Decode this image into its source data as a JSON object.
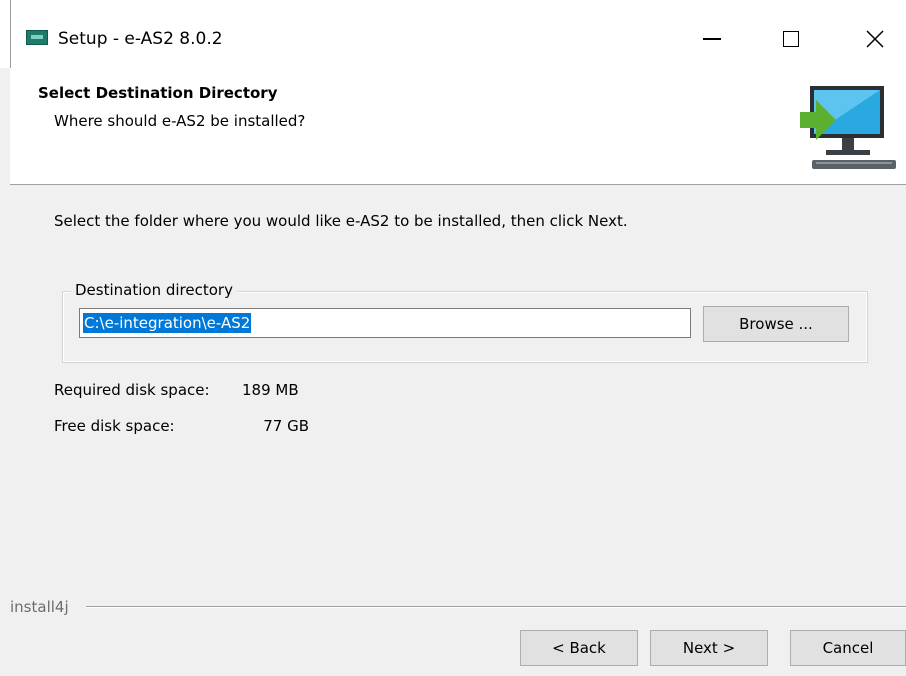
{
  "window": {
    "title": "Setup - e-AS2 8.0.2"
  },
  "header": {
    "title": "Select Destination Directory",
    "subtitle": "Where should e-AS2 be installed?"
  },
  "content": {
    "instruction": "Select the folder where you would like e-AS2 to be installed, then click Next.",
    "destination": {
      "legend": "Destination directory",
      "value": "C:\\e-integration\\e-AS2",
      "browse_label": "Browse ..."
    },
    "required_space_label": "Required disk space:",
    "required_space_value": "189 MB",
    "free_space_label": "Free disk space:",
    "free_space_value": "77 GB"
  },
  "footer": {
    "brand": "install4j",
    "back_label": "< Back",
    "next_label": "Next >",
    "cancel_label": "Cancel"
  },
  "colors": {
    "selection": "#0078d7",
    "monitor_screen": "#29a9e0",
    "arrow": "#5bb030"
  }
}
